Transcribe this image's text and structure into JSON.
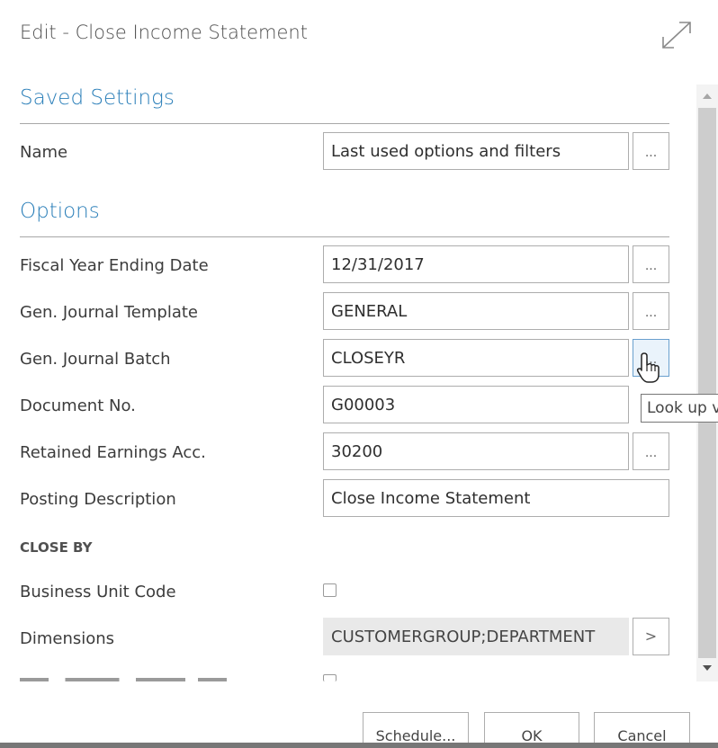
{
  "dialog": {
    "title": "Edit - Close Income Statement"
  },
  "saved_settings": {
    "section_title": "Saved Settings",
    "name_label": "Name",
    "name_value": "Last used options and filters",
    "lookup_label": "..."
  },
  "options": {
    "section_title": "Options",
    "fields": [
      {
        "label": "Fiscal Year Ending Date",
        "value": "12/31/2017",
        "button": "..."
      },
      {
        "label": "Gen. Journal Template",
        "value": "GENERAL",
        "button": "..."
      },
      {
        "label": "Gen. Journal Batch",
        "value": "CLOSEYR",
        "button": "..."
      },
      {
        "label": "Document No.",
        "value": "G00003"
      },
      {
        "label": "Retained Earnings Acc.",
        "value": "30200",
        "button": "..."
      },
      {
        "label": "Posting Description",
        "value": "Close Income Statement"
      }
    ]
  },
  "close_by": {
    "heading": "CLOSE BY",
    "business_unit_code_label": "Business Unit Code",
    "business_unit_code_checked": false,
    "dimensions_label": "Dimensions",
    "dimensions_value": "CUSTOMERGROUP;DEPARTMENT",
    "dimensions_button": ">"
  },
  "tooltip": {
    "text": "Look up v"
  },
  "footer": {
    "schedule_label": "Schedule...",
    "ok_label": "OK",
    "cancel_label": "Cancel"
  },
  "icons": {
    "expand": "expand-icon",
    "cursor": "hand-pointer-icon"
  },
  "colors": {
    "accent": "#2b7fb9",
    "border": "#adadad",
    "readonly_bg": "#e9e9e9"
  }
}
